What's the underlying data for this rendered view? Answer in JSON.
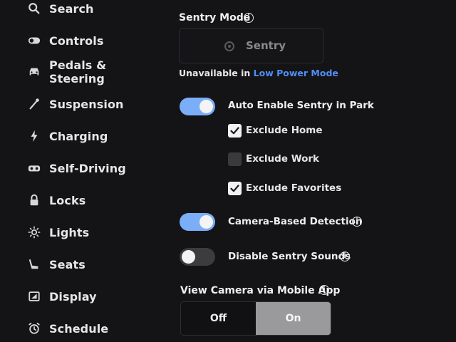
{
  "sidebar": {
    "items": [
      {
        "label": "Search",
        "icon": "search-icon"
      },
      {
        "label": "Controls",
        "icon": "toggle-icon"
      },
      {
        "label": "Pedals & Steering",
        "icon": "car-icon"
      },
      {
        "label": "Suspension",
        "icon": "suspension-icon"
      },
      {
        "label": "Charging",
        "icon": "bolt-icon"
      },
      {
        "label": "Self-Driving",
        "icon": "steering-wheel-icon"
      },
      {
        "label": "Locks",
        "icon": "lock-icon"
      },
      {
        "label": "Lights",
        "icon": "sun-icon"
      },
      {
        "label": "Seats",
        "icon": "seat-icon"
      },
      {
        "label": "Display",
        "icon": "display-icon"
      },
      {
        "label": "Schedule",
        "icon": "alarm-clock-icon"
      }
    ]
  },
  "sentry": {
    "title": "Sentry Mode",
    "button_label": "Sentry",
    "unavailable_text": "Unavailable in ",
    "unavailable_link": "Low Power Mode"
  },
  "auto_enable": {
    "label": "Auto Enable Sentry in Park",
    "enabled": true,
    "exclusions": [
      {
        "label": "Exclude Home",
        "checked": true
      },
      {
        "label": "Exclude Work",
        "checked": false
      },
      {
        "label": "Exclude Favorites",
        "checked": true
      }
    ]
  },
  "camera_detection": {
    "label": "Camera-Based Detection",
    "enabled": true
  },
  "disable_sounds": {
    "label": "Disable Sentry Sounds",
    "enabled": false
  },
  "mobile_app": {
    "title": "View Camera via Mobile App",
    "options": [
      "Off",
      "On"
    ],
    "selected": "On"
  },
  "colors": {
    "background": "#141416",
    "accent_toggle": "#7aaef7",
    "link": "#4f8ff7"
  }
}
